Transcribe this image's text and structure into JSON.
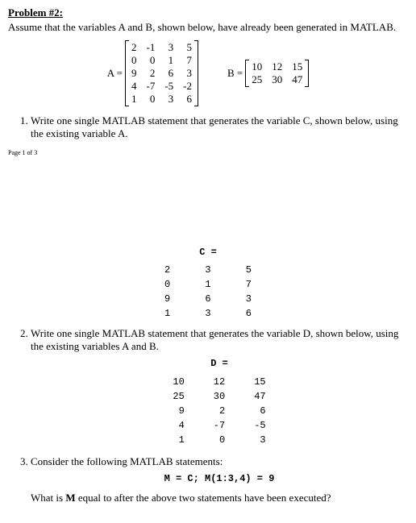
{
  "problem": {
    "title": "Problem #2:",
    "intro": "Assume that the variables A and B, shown below,  have already been generated in MATLAB."
  },
  "A": {
    "label": "A =",
    "rows": [
      [
        "2",
        "-1",
        "3",
        "5"
      ],
      [
        "0",
        "0",
        "1",
        "7"
      ],
      [
        "9",
        "2",
        "6",
        "3"
      ],
      [
        "4",
        "-7",
        "-5",
        "-2"
      ],
      [
        "1",
        "0",
        "3",
        "6"
      ]
    ]
  },
  "B": {
    "label": "B =",
    "rows": [
      [
        "10",
        "12",
        "15"
      ],
      [
        "25",
        "30",
        "47"
      ]
    ]
  },
  "q1": "Write one single MATLAB statement that generates the variable C, shown below, using the existing variable A.",
  "page_num": "Page 1 of 3",
  "C": {
    "label": "C =",
    "rows_text": "2      3      5\n0      1      7\n9      6      3\n1      3      6"
  },
  "q2": "Write one single MATLAB statement that generates the variable D, shown below, using the existing variables A and B.",
  "D": {
    "label": "D =",
    "rows_text": "10     12     15\n25     30     47\n 9      2      6\n 4     -7     -5\n 1      0      3"
  },
  "q3": {
    "lead": "Consider the following MATLAB statements:",
    "stmt": "M = C; M(1:3,4) = 9",
    "ask": "What is M equal to after the above two statements have been executed?"
  }
}
